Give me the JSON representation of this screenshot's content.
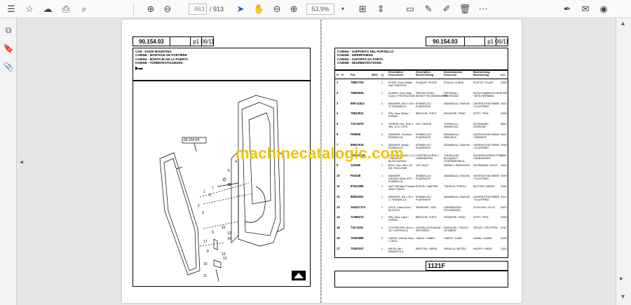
{
  "toolbar": {
    "current_page": "863",
    "total_pages": "/ 913",
    "zoom": "53,9%"
  },
  "left_page": {
    "code": "90.154.03",
    "page_ref": "p1",
    "date": "06/11",
    "titles": [
      "CAB - DOOR MOUNTING",
      "CABINE - MONTAGE DE PORTIÈRE",
      "CABINA - MONTAJE DE LA PUERTA",
      "KABINE - TÜRBEFESTIGUNGEN"
    ],
    "diagram_ref": "90.154.04",
    "callouts": [
      "1",
      "2",
      "3",
      "4",
      "5",
      "6",
      "7",
      "8",
      "9",
      "10",
      "11",
      "12",
      "13",
      "14",
      "15",
      "16",
      "17"
    ]
  },
  "right_page": {
    "code": "90.154.03",
    "page_ref": "p1",
    "date": "06/11",
    "titles": [
      "CABINA - SUPPORTO DEL PORTELLO",
      "KABINE - DØRØPHÆNG",
      "CABINA - SUPORTE DA PORTA",
      "CABINE - DEURBEVESTIGING"
    ],
    "columns": [
      "R",
      "N",
      "P.N.",
      "MOD",
      "Q",
      "Description Descrizione",
      "Description Beschreibung",
      "Denominacion Descricao",
      "Bezeichnung Bezeichning",
      "U.C."
    ],
    "rows": [
      {
        "r": "1",
        "pn": "76867753",
        "q": "1",
        "d1": "PLATE, Door Striker Nut / PIASTRA",
        "d2": "PLAQUE / PLATE",
        "d3": "PLACA / CHAPA",
        "d4": "PLATTE / PLAAT",
        "uc": "X99V"
      },
      {
        "r": "2",
        "pn": "76840626",
        "q": "1",
        "d1": "GUARD, Door Stop Cover / PROTEZIONE",
        "d2": "PROTECTION / BESKYTTELSESSKJERM",
        "d3": "DEFENSA / PROTEÇÃO",
        "d4": "SCHUTZABDECKUNG / AFSCHERMING",
        "uc": "070R"
      },
      {
        "r": "3",
        "pn": "895-11812",
        "q": "4",
        "d1": "WASHER, M10 x 30 x 3 / RONDELLA",
        "d2": "RONDELLE / PLADSKIVE",
        "d3": "ARANDELA / ANILHA",
        "d4": "UNTERLEGSCHEIBE / SLUITRING",
        "uc": "3103"
      },
      {
        "r": "4",
        "pn": "76843511",
        "q": "1",
        "d1": "PIN, Door Striker / PERNO",
        "d2": "BROCHE / STIFT",
        "d3": "PASADOR / PINO",
        "d4": "STIFT / PEN",
        "uc": "X99V"
      },
      {
        "r": "5",
        "pn": "73174475",
        "q": "1",
        "d1": "SCREW, Hex, M10 x 100, 10.9 / VITE",
        "d2": "VIS / SKRUE",
        "d3": "TORNILLO / PARAFUSO",
        "d4": "SCHRAUBE / SCHROEF",
        "uc": "985V"
      },
      {
        "r": "6",
        "pn": "F64846",
        "q": "2",
        "d1": "WASHER, Flexlock / RONDELLA",
        "d2": "RONDELLE / PLADSKIVE",
        "d3": "ARANDELA / ARRUELA",
        "d4": "UNTERLEGSCHEIBE / WASHER",
        "uc": "0320"
      },
      {
        "r": "7",
        "pn": "86547619",
        "q": "2",
        "d1": "WASHER, Brass / RONDELLA",
        "d2": "RONDELLE / PLADSKIVE",
        "d3": "ARANDELA / ANILHA",
        "d4": "UNTERLEGSCHEIBE / SLUITRING",
        "uc": "X99V"
      },
      {
        "r": "8",
        "pn": "832-10418",
        "q": "1",
        "d1": "LOCK NUT, M10 x 1.5 / DADO DI BLOCCAGGIO",
        "d2": "CONTRE-ÉCROU / LÅSEMØTRIK",
        "d3": "TUERCA DE BLOQUEO / CONTRAPORCA",
        "d4": "SICHERUNGSMUTTER / BORGMOER",
        "uc": "3560"
      },
      {
        "r": "9",
        "pn": "126186",
        "q": "1",
        "d1": "BOLT, Hex, M8 x 20, 8.8 / BULLONE",
        "d2": "VIS / BOLT",
        "d3": "PERNO / PARAFUSO",
        "d4": "SCHRAUBE / BOUT",
        "uc": "1400"
      },
      {
        "r": "10",
        "pn": "F63448",
        "q": "1",
        "d1": "WASHER, 8.5x13x1.6mm ZZT / RONDELLA",
        "d2": "RONDELLE / PLADSKIVE",
        "d3": "ARANDELA / ANILHA",
        "d4": "UNTERLEGSCHEIBE / SLUITRING",
        "uc": "X99V"
      },
      {
        "r": "11",
        "pn": "87814365",
        "q": "1",
        "d1": "NUT, M8 Max Pressed Steel / DADO",
        "d2": "ÉCROU / MØTRIK",
        "d3": "TUERCA / PORCA",
        "d4": "MUTTER / MOER",
        "uc": "0160"
      },
      {
        "r": "12",
        "pn": "86825261",
        "q": "1",
        "d1": "WASHER, M6 x 19 x 1 / RONDELLA",
        "d2": "RONDELLE / PLADSKIVE",
        "d3": "ARANDELA / ANILHA",
        "d4": "UNTERLEGSCHEIBE / SLUITRING",
        "uc": "3103"
      },
      {
        "r": "13",
        "pn": "154227170",
        "q": "1",
        "d1": "LOCK, Latch Door / BLOCCO",
        "d2": "SERRURE / LÅS",
        "d3": "CERRADURA / FECHADURA",
        "d4": "SCHLOSS / SLOT",
        "uc": "290X"
      },
      {
        "r": "14",
        "pn": "71485274",
        "q": "1",
        "d1": "PIN, Door Latch / PERNO",
        "d2": "BROCHE / STIFT",
        "d3": "PASADOR / PINO",
        "d4": "STIFT / PEN",
        "uc": "X99V"
      },
      {
        "r": "15",
        "pn": "732-1616",
        "q": "2",
        "d1": "COTTER PIN, M1.6 x 16 / COPPIGLIA",
        "d2": "GOUPILLE FENDUE / SPLITBOLT",
        "d3": "PASADOR / TROCO DE ABRIR",
        "d4": "SPLINT / SPLITPEN",
        "uc": "3740"
      },
      {
        "r": "16",
        "pn": "76363589",
        "q": "1",
        "d1": "CABLE, Vinculo Door / CAVO",
        "d2": "CÂBLE / KABEL",
        "d3": "CABLE / CABO",
        "d4": "KABEL / KABEL",
        "uc": "X99V"
      },
      {
        "r": "17",
        "pn": "76363157",
        "q": "1",
        "d1": "KNOB, M6 / MANOPOLA",
        "d2": "BOUTON / GREB",
        "d3": "PERILLA / BOTÃO",
        "d4": "KNOPF / KNOP",
        "uc": "1429"
      }
    ],
    "footer_code": "1121F"
  },
  "watermark": "machinecatalogic.com"
}
